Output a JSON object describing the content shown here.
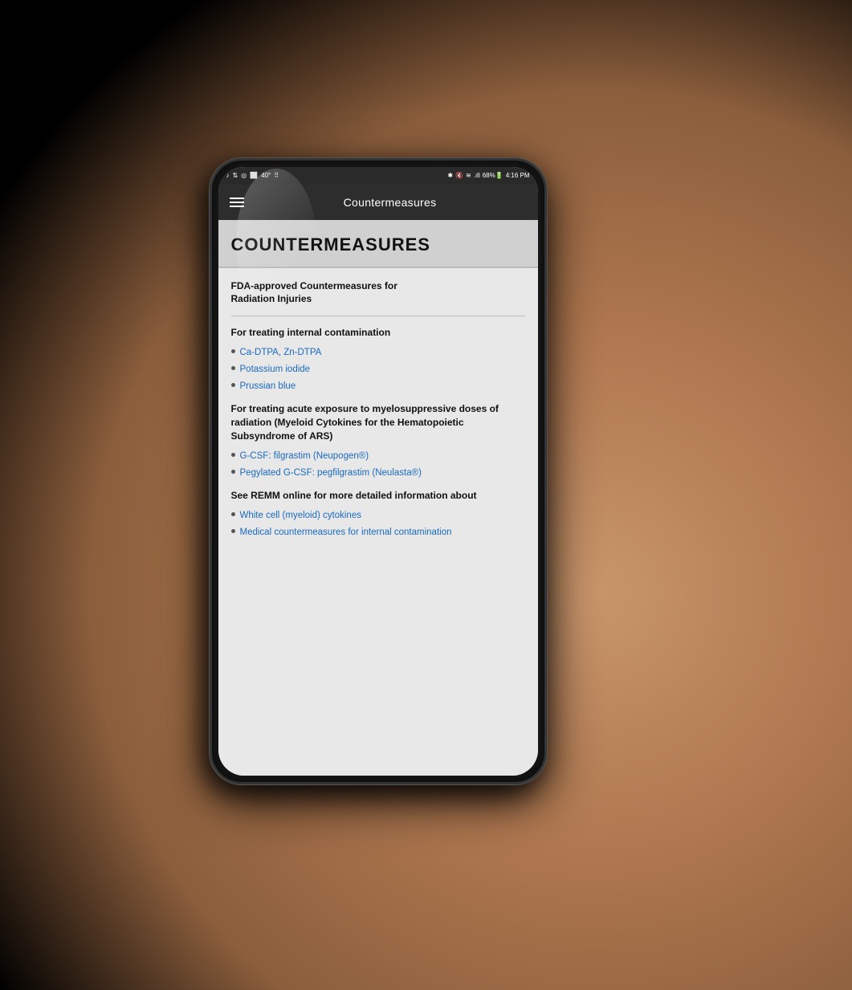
{
  "background": {
    "description": "hand holding phone background"
  },
  "phone": {
    "status_bar": {
      "left_icons": "● ↕ ◎ ⬜ 40° ⠿",
      "right_icons": "✱ 🔇 ≋ .ıll 68%🔋 4:16 PM"
    },
    "toolbar": {
      "title": "Countermeasures",
      "menu_icon": "≡"
    },
    "page": {
      "title": "COUNTERMEASURES",
      "sections": [
        {
          "id": "fda-section",
          "heading": "FDA-approved Countermeasures for Radiation Injuries",
          "subsections": [
            {
              "id": "internal-contamination",
              "heading": "For treating internal contamination",
              "items": [
                {
                  "id": "ca-dtpa",
                  "text": "Ca-DTPA, Zn-DTPA",
                  "is_link": true
                },
                {
                  "id": "potassium-iodide",
                  "text": "Potassium iodide",
                  "is_link": true
                },
                {
                  "id": "prussian-blue",
                  "text": "Prussian blue",
                  "is_link": true
                }
              ]
            },
            {
              "id": "myelosuppressive",
              "heading": "For treating acute exposure to myelosuppressive doses of radiation (Myeloid Cytokines for the Hematopoietic Subsyndrome of ARS)",
              "items": [
                {
                  "id": "gcsf",
                  "text": "G-CSF: filgrastim (Neupogen®)",
                  "is_link": true
                },
                {
                  "id": "pegylated-gcsf",
                  "text": "Pegylated G-CSF: pegfilgrastim (Neulasta®)",
                  "is_link": true
                }
              ]
            }
          ]
        },
        {
          "id": "remm-section",
          "heading": "See REMM online for more detailed information about",
          "items": [
            {
              "id": "white-cell",
              "text": "White cell (myeloid) cytokines",
              "is_link": true
            },
            {
              "id": "medical-countermeasures",
              "text": "Medical countermeasures for internal contamination",
              "is_link": true
            }
          ]
        }
      ]
    }
  },
  "colors": {
    "toolbar_bg": "#2d2d2d",
    "page_bg": "#e8e8e8",
    "title_banner_bg": "#d0d0d0",
    "link_color": "#1a6abf",
    "text_color": "#111",
    "bullet_color": "#555"
  }
}
